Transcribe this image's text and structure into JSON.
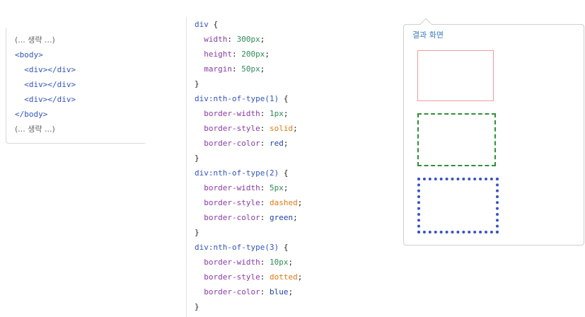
{
  "html_snippet": {
    "lines": [
      "(... 생략 ...)",
      "<body>",
      "  <div></div>",
      "  <div></div>",
      "  <div></div>",
      "</body>",
      "(... 생략 ...)"
    ]
  },
  "css_code": {
    "rule0_selector": "div",
    "rule0_open": " {",
    "rule0_decl": [
      {
        "prop": "width",
        "value": "300px"
      },
      {
        "prop": "height",
        "value": "200px"
      },
      {
        "prop": "margin",
        "value": "50px"
      }
    ],
    "rule1_selector": "div:nth-of-type(1)",
    "rule1_decl": [
      {
        "prop": "border-width",
        "value": "1px"
      },
      {
        "prop": "border-style",
        "value": "solid"
      },
      {
        "prop": "border-color",
        "value": "red"
      }
    ],
    "rule2_selector": "div:nth-of-type(2)",
    "rule2_decl": [
      {
        "prop": "border-width",
        "value": "5px"
      },
      {
        "prop": "border-style",
        "value": "dashed"
      },
      {
        "prop": "border-color",
        "value": "green"
      }
    ],
    "rule3_selector": "div:nth-of-type(3)",
    "rule3_decl": [
      {
        "prop": "border-width",
        "value": "10px"
      },
      {
        "prop": "border-style",
        "value": "dotted"
      },
      {
        "prop": "border-color",
        "value": "blue"
      }
    ],
    "close_brace": "}"
  },
  "result": {
    "title": "결과 화면"
  },
  "colors": {
    "selector": "#3355bb",
    "property": "#8b3aa8",
    "number": "#2e8b57",
    "keyword": "#e07a10",
    "result_title": "#3a78c0",
    "box1_border": "#f29aa0",
    "box2_border": "#2f8f3a",
    "box3_border": "#3a52c4"
  }
}
